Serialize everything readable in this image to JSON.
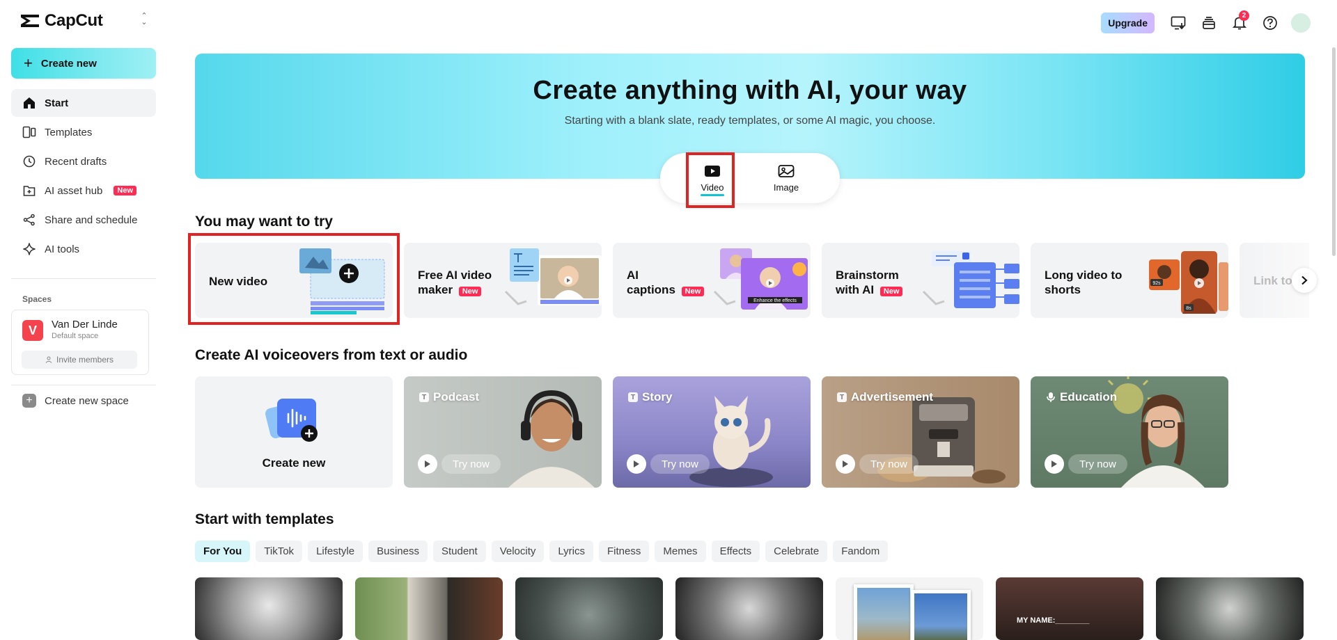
{
  "app": {
    "name": "CapCut"
  },
  "sidebar": {
    "create_label": "Create new",
    "items": [
      {
        "label": "Start",
        "icon": "home-icon"
      },
      {
        "label": "Templates",
        "icon": "templates-icon"
      },
      {
        "label": "Recent drafts",
        "icon": "clock-icon"
      },
      {
        "label": "AI asset hub",
        "icon": "asset-hub-icon",
        "badge": "New"
      },
      {
        "label": "Share and schedule",
        "icon": "share-icon"
      },
      {
        "label": "AI tools",
        "icon": "sparkle-icon"
      }
    ],
    "spaces_title": "Spaces",
    "space": {
      "initial": "V",
      "name": "Van Der Linde",
      "subtitle": "Default space",
      "invite_label": "Invite members"
    },
    "new_space_label": "Create new space"
  },
  "topbar": {
    "upgrade_label": "Upgrade",
    "notification_count": "2"
  },
  "hero": {
    "title": "Create anything with AI, your way",
    "subtitle": "Starting with a blank slate, ready templates, or some AI magic, you choose.",
    "tabs": [
      {
        "label": "Video"
      },
      {
        "label": "Image"
      }
    ]
  },
  "try_section": {
    "title": "You may want to try",
    "cards": [
      {
        "title": "New video"
      },
      {
        "title": "Free AI video maker",
        "line1": "Free AI video",
        "line2": "maker",
        "badge": "New"
      },
      {
        "title": "AI captions",
        "line1": "AI",
        "line2": "captions",
        "badge": "New",
        "art_caption": "Enhance the effects"
      },
      {
        "title": "Brainstorm with AI",
        "line1": "Brainstorm",
        "line2": "with AI",
        "badge": "New"
      },
      {
        "title": "Long video to shorts",
        "line1": "Long video to",
        "line2": "shorts",
        "tag1": "92s",
        "tag2": "8s"
      }
    ],
    "partial_card": "Link to"
  },
  "voiceover_section": {
    "title": "Create AI voiceovers from text or audio",
    "create_label": "Create new",
    "cards": [
      {
        "label": "Podcast",
        "cta": "Try now"
      },
      {
        "label": "Story",
        "cta": "Try now"
      },
      {
        "label": "Advertisement",
        "cta": "Try now"
      },
      {
        "label": "Education",
        "cta": "Try now"
      }
    ]
  },
  "templates_section": {
    "title": "Start with templates",
    "chips": [
      "For You",
      "TikTok",
      "Lifestyle",
      "Business",
      "Student",
      "Velocity",
      "Lyrics",
      "Fitness",
      "Memes",
      "Effects",
      "Celebrate",
      "Fandom"
    ],
    "thumb_caption": "MY NAME:________"
  },
  "colors": {
    "accent": "#12c3d6",
    "badge": "#fe2c55",
    "highlight_frame": "#e02424"
  }
}
